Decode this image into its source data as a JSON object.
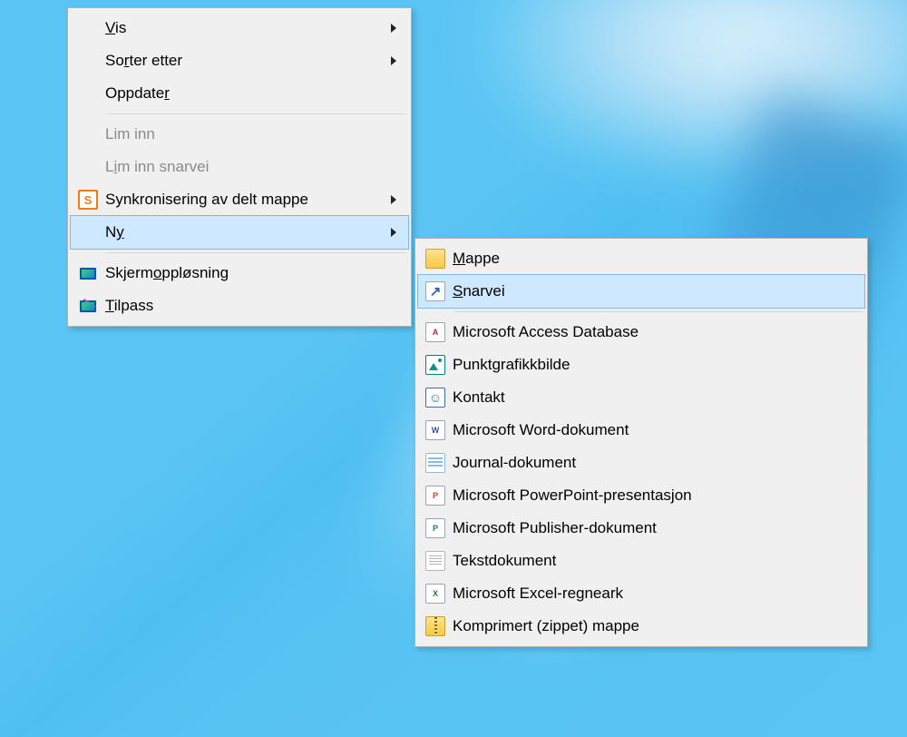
{
  "context_menu": {
    "items": [
      {
        "label_pre": "",
        "u": "V",
        "label_post": "is",
        "has_sub": true
      },
      {
        "label_pre": "So",
        "u": "r",
        "label_post": "ter etter",
        "has_sub": true
      },
      {
        "label_pre": "Oppdate",
        "u": "r",
        "label_post": ""
      },
      {
        "sep": true
      },
      {
        "label_pre": "Lim inn",
        "u": "",
        "label_post": "",
        "disabled": true
      },
      {
        "label_pre": "L",
        "u": "i",
        "label_post": "m inn snarvei",
        "disabled": true
      },
      {
        "label_pre": "Synkronisering av delt mappe",
        "u": "",
        "label_post": "",
        "has_sub": true,
        "icon": "sync"
      },
      {
        "label_pre": "N",
        "u": "y",
        "label_post": "",
        "has_sub": true,
        "selected": true
      },
      {
        "sep": true
      },
      {
        "label_pre": "Skjerm",
        "u": "o",
        "label_post": "ppløsning",
        "icon": "screen"
      },
      {
        "label_pre": "",
        "u": "T",
        "label_post": "ilpass",
        "icon": "screenb"
      }
    ]
  },
  "submenu": {
    "items": [
      {
        "label_pre": "",
        "u": "M",
        "label_post": "appe",
        "icon": "folder"
      },
      {
        "label_pre": "",
        "u": "S",
        "label_post": "narvei",
        "icon": "shortcut",
        "selected": true
      },
      {
        "sep": true
      },
      {
        "label_pre": "Microsoft Access Database",
        "icon": "access"
      },
      {
        "label_pre": "Punktgrafikkbilde",
        "icon": "pic"
      },
      {
        "label_pre": "Kontakt",
        "icon": "contact"
      },
      {
        "label_pre": "Microsoft Word-dokument",
        "icon": "word"
      },
      {
        "label_pre": "Journal-dokument",
        "icon": "journal"
      },
      {
        "label_pre": "Microsoft PowerPoint-presentasjon",
        "icon": "ppt"
      },
      {
        "label_pre": "Microsoft Publisher-dokument",
        "icon": "pub"
      },
      {
        "label_pre": "Tekstdokument",
        "icon": "text"
      },
      {
        "label_pre": "Microsoft Excel-regneark",
        "icon": "xls"
      },
      {
        "label_pre": "Komprimert (zippet) mappe",
        "icon": "zip"
      }
    ]
  },
  "icons": {
    "sync_letter": "S",
    "contact_glyph": "☺"
  }
}
